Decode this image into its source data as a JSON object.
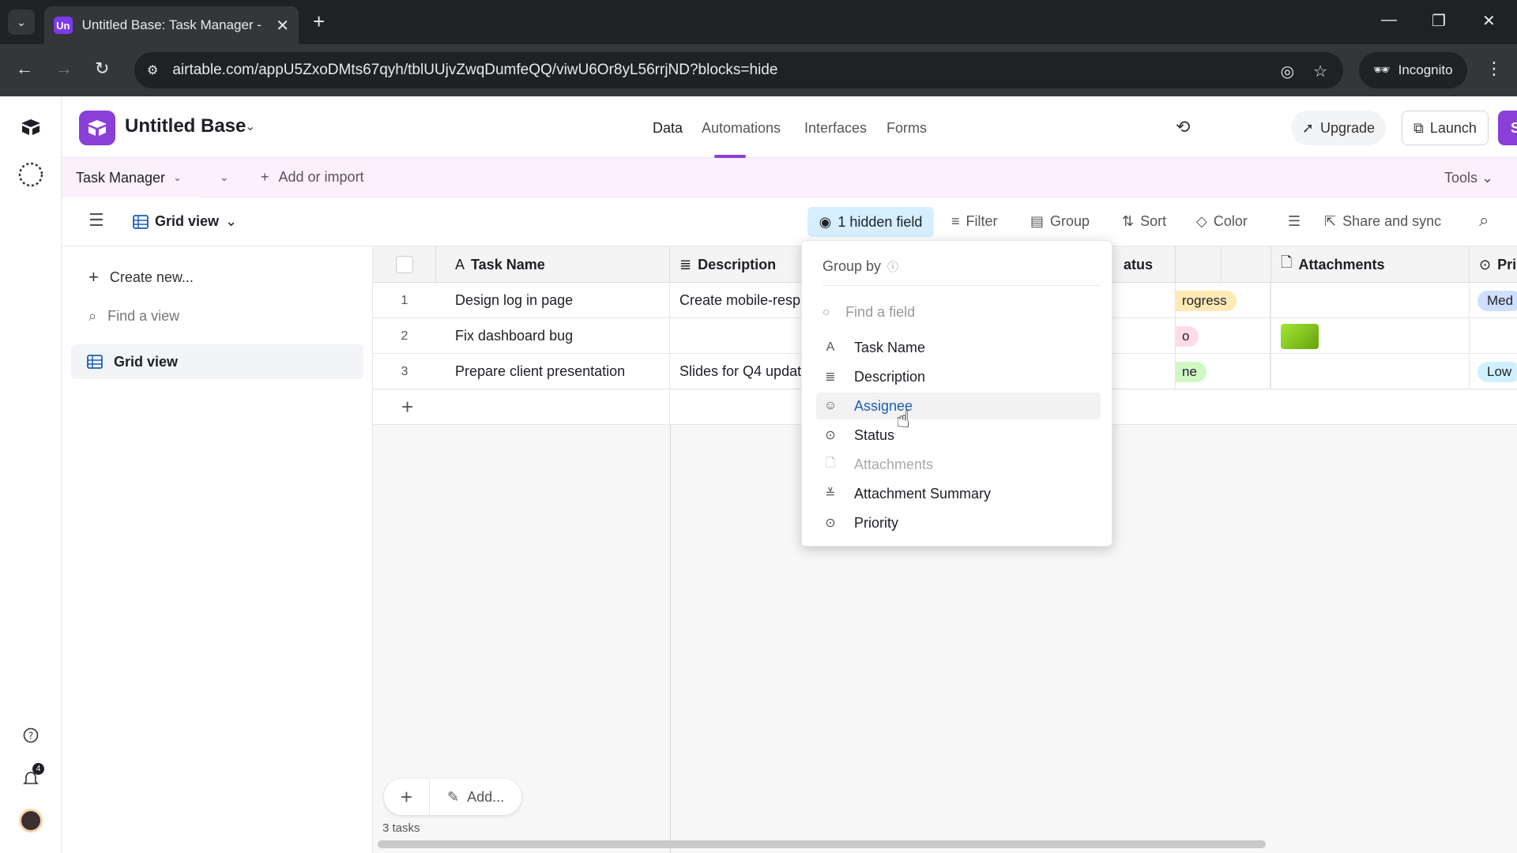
{
  "browser": {
    "tab_title": "Untitled Base: Task Manager - /",
    "favicon_text": "Un",
    "url": "airtable.com/appU5ZxoDMts67qyh/tblUUjvZwqDumfeQQ/viwU6Or8yL56rrjND?blocks=hide",
    "incognito_label": "Incognito"
  },
  "header": {
    "base_name": "Untitled Base",
    "nav_tabs": [
      "Data",
      "Automations",
      "Interfaces",
      "Forms"
    ],
    "upgrade_label": "Upgrade",
    "launch_label": "Launch",
    "share_label": "Share",
    "brand_color": "#8b3fd9"
  },
  "tablebar": {
    "table_name": "Task Manager",
    "add_import_label": "Add or import",
    "tools_label": "Tools"
  },
  "viewbar": {
    "view_name": "Grid view",
    "hidden_fields_label": "1 hidden field",
    "filter_label": "Filter",
    "group_label": "Group",
    "sort_label": "Sort",
    "color_label": "Color",
    "share_sync_label": "Share and sync"
  },
  "sidebar": {
    "create_new_label": "Create new...",
    "find_view_placeholder": "Find a view",
    "active_view": "Grid view",
    "notification_count": "4"
  },
  "grid": {
    "columns": [
      "Task Name",
      "Description",
      "atus",
      "Attachments",
      "Pri"
    ],
    "rows": [
      {
        "num": "1",
        "task": "Design log in page",
        "description": "Create mobile-resp",
        "status": "rogress",
        "status_color": "#ffeab6",
        "priority": "Med",
        "priority_color": "#cfdfff"
      },
      {
        "num": "2",
        "task": "Fix dashboard bug",
        "description": "",
        "status": "o",
        "status_color": "#ffdce5",
        "priority": "",
        "priority_color": ""
      },
      {
        "num": "3",
        "task": "Prepare client presentation",
        "description": "Slides for Q4 updat",
        "status": "ne",
        "status_color": "#d1f7c4",
        "priority": "Low",
        "priority_color": "#d0f0fd"
      }
    ],
    "add_label": "Add...",
    "record_count": "3 tasks"
  },
  "group_by": {
    "title": "Group by",
    "find_placeholder": "Find a field",
    "fields": [
      {
        "label": "Task Name",
        "icon": "text-icon"
      },
      {
        "label": "Description",
        "icon": "long-text-icon"
      },
      {
        "label": "Assignee",
        "icon": "user-icon"
      },
      {
        "label": "Status",
        "icon": "single-select-icon"
      },
      {
        "label": "Attachments",
        "icon": "attachment-icon"
      },
      {
        "label": "Attachment Summary",
        "icon": "ai-summary-icon"
      },
      {
        "label": "Priority",
        "icon": "single-select-icon"
      }
    ]
  }
}
